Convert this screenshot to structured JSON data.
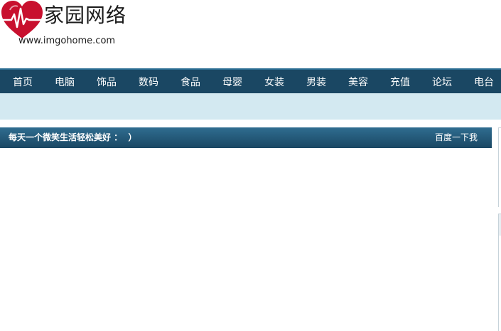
{
  "header": {
    "brand_name": "家园网络",
    "brand_url": "www.imgohome.com",
    "logo_icon": "heart-pulse-icon",
    "logo_color": "#c8102e"
  },
  "nav": {
    "items": [
      {
        "label": "首页"
      },
      {
        "label": "电脑"
      },
      {
        "label": "饰品"
      },
      {
        "label": "数码"
      },
      {
        "label": "食品"
      },
      {
        "label": "母婴"
      },
      {
        "label": "女装"
      },
      {
        "label": "男装"
      },
      {
        "label": "美容"
      },
      {
        "label": "充值"
      },
      {
        "label": "论坛"
      },
      {
        "label": "电台"
      }
    ],
    "background": "#1a4763"
  },
  "subbar": {
    "background": "#d3e9f1"
  },
  "titlebar": {
    "slogan": "每天一个微笑生活轻松美好 ：  ）",
    "baidu_link": "百度一下我"
  }
}
